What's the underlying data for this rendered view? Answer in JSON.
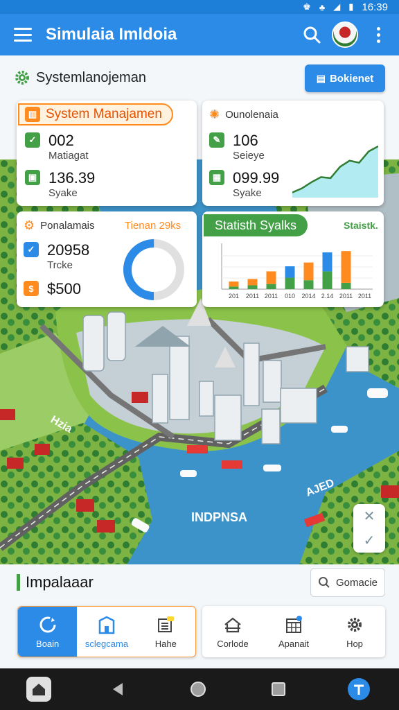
{
  "status_bar": {
    "time": "16:39"
  },
  "app_bar": {
    "title": "Simulaia Imldoia"
  },
  "header": {
    "section_title": "Systemlanojeman",
    "action_button": "Bokienet"
  },
  "card_system": {
    "title": "System Manajamen",
    "stats": [
      {
        "value": "002",
        "label": "Matiagat"
      },
      {
        "value": "136.39",
        "label": "Syake"
      }
    ]
  },
  "card_overview": {
    "title": "Ounolenaia",
    "stats": [
      {
        "value": "106",
        "label": "Seieye"
      },
      {
        "value": "099.99",
        "label": "Syake"
      }
    ],
    "sparkline": [
      10,
      18,
      30,
      40,
      38,
      60,
      72,
      68,
      90,
      100
    ]
  },
  "card_personal": {
    "title": "Ponalamais",
    "badge": "Tienan 29ks",
    "stats": [
      {
        "value": "20958",
        "label": "Trcke"
      },
      {
        "value": "$500",
        "label": ""
      }
    ],
    "donut_fraction": 0.5
  },
  "chart_data": {
    "type": "bar",
    "title": "Statisth Syalks",
    "subtitle": "Staistk.",
    "categories": [
      "201",
      "2011",
      "2011",
      "010",
      "2014",
      "2.14",
      "2011",
      "2011"
    ],
    "series": [
      {
        "color": "#43a047",
        "values": [
          4,
          6,
          8,
          18,
          14,
          28,
          10,
          0
        ]
      },
      {
        "color": "#ff8a1e",
        "values": [
          8,
          10,
          20,
          0,
          28,
          0,
          50,
          0
        ]
      },
      {
        "color": "#2b8be6",
        "values": [
          0,
          0,
          0,
          18,
          0,
          30,
          0,
          0
        ]
      }
    ],
    "ylim": [
      0,
      70
    ]
  },
  "map": {
    "label_left": "Hzia",
    "label_center": "INDPNSA",
    "label_right": "AJED"
  },
  "bottom": {
    "title": "Impalaaar",
    "search_label": "Gomacie",
    "nav": [
      {
        "label": "Boain",
        "icon": "refresh-icon"
      },
      {
        "label": "sclegcama",
        "icon": "building-icon"
      },
      {
        "label": "Hahe",
        "icon": "news-icon"
      },
      {
        "label": "Corlode",
        "icon": "home-icon"
      },
      {
        "label": "Apanait",
        "icon": "calendar-icon"
      },
      {
        "label": "Hop",
        "icon": "gear-icon"
      }
    ]
  }
}
